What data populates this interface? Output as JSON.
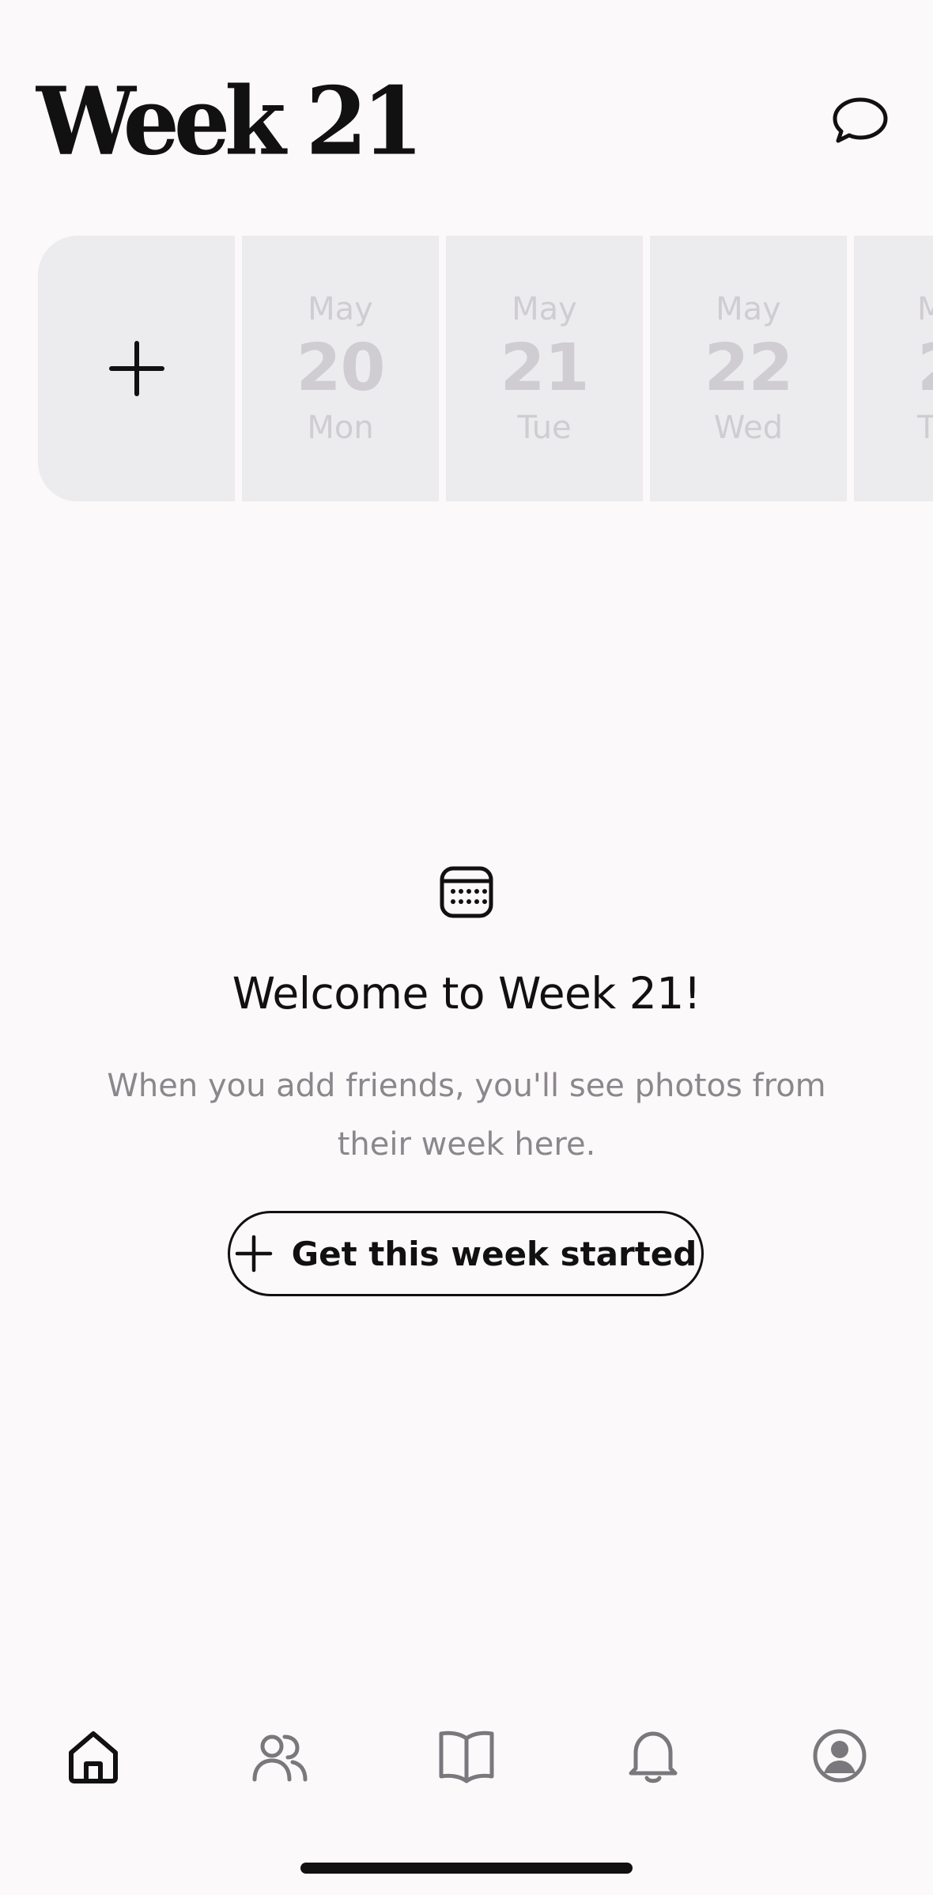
{
  "header": {
    "title": "Week 21"
  },
  "day_strip": {
    "add_label": "+",
    "days": [
      {
        "month": "May",
        "day": "20",
        "weekday": "Mon"
      },
      {
        "month": "May",
        "day": "21",
        "weekday": "Tue"
      },
      {
        "month": "May",
        "day": "22",
        "weekday": "Wed"
      },
      {
        "month": "M",
        "day": "2",
        "weekday": "T"
      }
    ]
  },
  "empty_state": {
    "icon": "calendar-icon",
    "title": "Welcome to Week 21!",
    "message": "When you add friends, you'll see photos from their week here.",
    "button_label": "Get this week started"
  },
  "tabbar": {
    "items": [
      {
        "icon": "home-icon",
        "active": true
      },
      {
        "icon": "friends-icon",
        "active": false
      },
      {
        "icon": "book-icon",
        "active": false
      },
      {
        "icon": "bell-icon",
        "active": false
      },
      {
        "icon": "profile-icon",
        "active": false
      }
    ]
  },
  "colors": {
    "background": "#fcf9fa",
    "card": "#ecebed",
    "card_text": "#cfcdd1",
    "text": "#111111",
    "muted": "#8a888c",
    "inactive_icon": "#7a787c"
  }
}
